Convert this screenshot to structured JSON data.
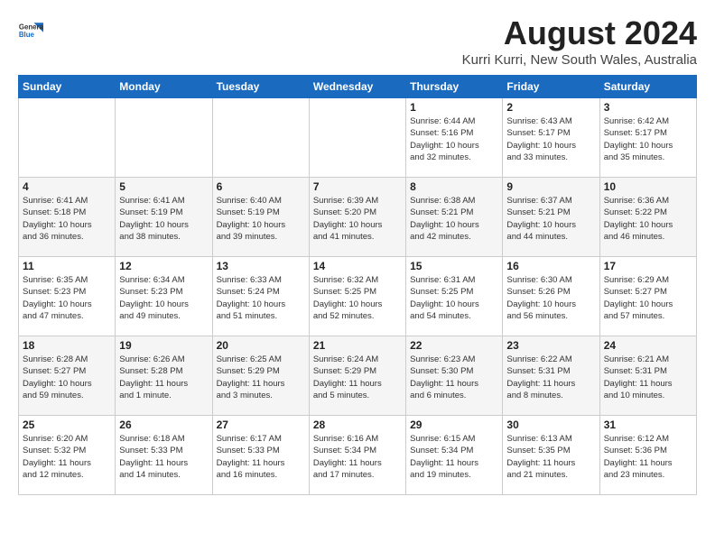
{
  "header": {
    "logo_line1": "General",
    "logo_line2": "Blue",
    "title": "August 2024",
    "subtitle": "Kurri Kurri, New South Wales, Australia"
  },
  "days_of_week": [
    "Sunday",
    "Monday",
    "Tuesday",
    "Wednesday",
    "Thursday",
    "Friday",
    "Saturday"
  ],
  "weeks": [
    [
      {
        "day": "",
        "info": ""
      },
      {
        "day": "",
        "info": ""
      },
      {
        "day": "",
        "info": ""
      },
      {
        "day": "",
        "info": ""
      },
      {
        "day": "1",
        "info": "Sunrise: 6:44 AM\nSunset: 5:16 PM\nDaylight: 10 hours\nand 32 minutes."
      },
      {
        "day": "2",
        "info": "Sunrise: 6:43 AM\nSunset: 5:17 PM\nDaylight: 10 hours\nand 33 minutes."
      },
      {
        "day": "3",
        "info": "Sunrise: 6:42 AM\nSunset: 5:17 PM\nDaylight: 10 hours\nand 35 minutes."
      }
    ],
    [
      {
        "day": "4",
        "info": "Sunrise: 6:41 AM\nSunset: 5:18 PM\nDaylight: 10 hours\nand 36 minutes."
      },
      {
        "day": "5",
        "info": "Sunrise: 6:41 AM\nSunset: 5:19 PM\nDaylight: 10 hours\nand 38 minutes."
      },
      {
        "day": "6",
        "info": "Sunrise: 6:40 AM\nSunset: 5:19 PM\nDaylight: 10 hours\nand 39 minutes."
      },
      {
        "day": "7",
        "info": "Sunrise: 6:39 AM\nSunset: 5:20 PM\nDaylight: 10 hours\nand 41 minutes."
      },
      {
        "day": "8",
        "info": "Sunrise: 6:38 AM\nSunset: 5:21 PM\nDaylight: 10 hours\nand 42 minutes."
      },
      {
        "day": "9",
        "info": "Sunrise: 6:37 AM\nSunset: 5:21 PM\nDaylight: 10 hours\nand 44 minutes."
      },
      {
        "day": "10",
        "info": "Sunrise: 6:36 AM\nSunset: 5:22 PM\nDaylight: 10 hours\nand 46 minutes."
      }
    ],
    [
      {
        "day": "11",
        "info": "Sunrise: 6:35 AM\nSunset: 5:23 PM\nDaylight: 10 hours\nand 47 minutes."
      },
      {
        "day": "12",
        "info": "Sunrise: 6:34 AM\nSunset: 5:23 PM\nDaylight: 10 hours\nand 49 minutes."
      },
      {
        "day": "13",
        "info": "Sunrise: 6:33 AM\nSunset: 5:24 PM\nDaylight: 10 hours\nand 51 minutes."
      },
      {
        "day": "14",
        "info": "Sunrise: 6:32 AM\nSunset: 5:25 PM\nDaylight: 10 hours\nand 52 minutes."
      },
      {
        "day": "15",
        "info": "Sunrise: 6:31 AM\nSunset: 5:25 PM\nDaylight: 10 hours\nand 54 minutes."
      },
      {
        "day": "16",
        "info": "Sunrise: 6:30 AM\nSunset: 5:26 PM\nDaylight: 10 hours\nand 56 minutes."
      },
      {
        "day": "17",
        "info": "Sunrise: 6:29 AM\nSunset: 5:27 PM\nDaylight: 10 hours\nand 57 minutes."
      }
    ],
    [
      {
        "day": "18",
        "info": "Sunrise: 6:28 AM\nSunset: 5:27 PM\nDaylight: 10 hours\nand 59 minutes."
      },
      {
        "day": "19",
        "info": "Sunrise: 6:26 AM\nSunset: 5:28 PM\nDaylight: 11 hours\nand 1 minute."
      },
      {
        "day": "20",
        "info": "Sunrise: 6:25 AM\nSunset: 5:29 PM\nDaylight: 11 hours\nand 3 minutes."
      },
      {
        "day": "21",
        "info": "Sunrise: 6:24 AM\nSunset: 5:29 PM\nDaylight: 11 hours\nand 5 minutes."
      },
      {
        "day": "22",
        "info": "Sunrise: 6:23 AM\nSunset: 5:30 PM\nDaylight: 11 hours\nand 6 minutes."
      },
      {
        "day": "23",
        "info": "Sunrise: 6:22 AM\nSunset: 5:31 PM\nDaylight: 11 hours\nand 8 minutes."
      },
      {
        "day": "24",
        "info": "Sunrise: 6:21 AM\nSunset: 5:31 PM\nDaylight: 11 hours\nand 10 minutes."
      }
    ],
    [
      {
        "day": "25",
        "info": "Sunrise: 6:20 AM\nSunset: 5:32 PM\nDaylight: 11 hours\nand 12 minutes."
      },
      {
        "day": "26",
        "info": "Sunrise: 6:18 AM\nSunset: 5:33 PM\nDaylight: 11 hours\nand 14 minutes."
      },
      {
        "day": "27",
        "info": "Sunrise: 6:17 AM\nSunset: 5:33 PM\nDaylight: 11 hours\nand 16 minutes."
      },
      {
        "day": "28",
        "info": "Sunrise: 6:16 AM\nSunset: 5:34 PM\nDaylight: 11 hours\nand 17 minutes."
      },
      {
        "day": "29",
        "info": "Sunrise: 6:15 AM\nSunset: 5:34 PM\nDaylight: 11 hours\nand 19 minutes."
      },
      {
        "day": "30",
        "info": "Sunrise: 6:13 AM\nSunset: 5:35 PM\nDaylight: 11 hours\nand 21 minutes."
      },
      {
        "day": "31",
        "info": "Sunrise: 6:12 AM\nSunset: 5:36 PM\nDaylight: 11 hours\nand 23 minutes."
      }
    ]
  ]
}
